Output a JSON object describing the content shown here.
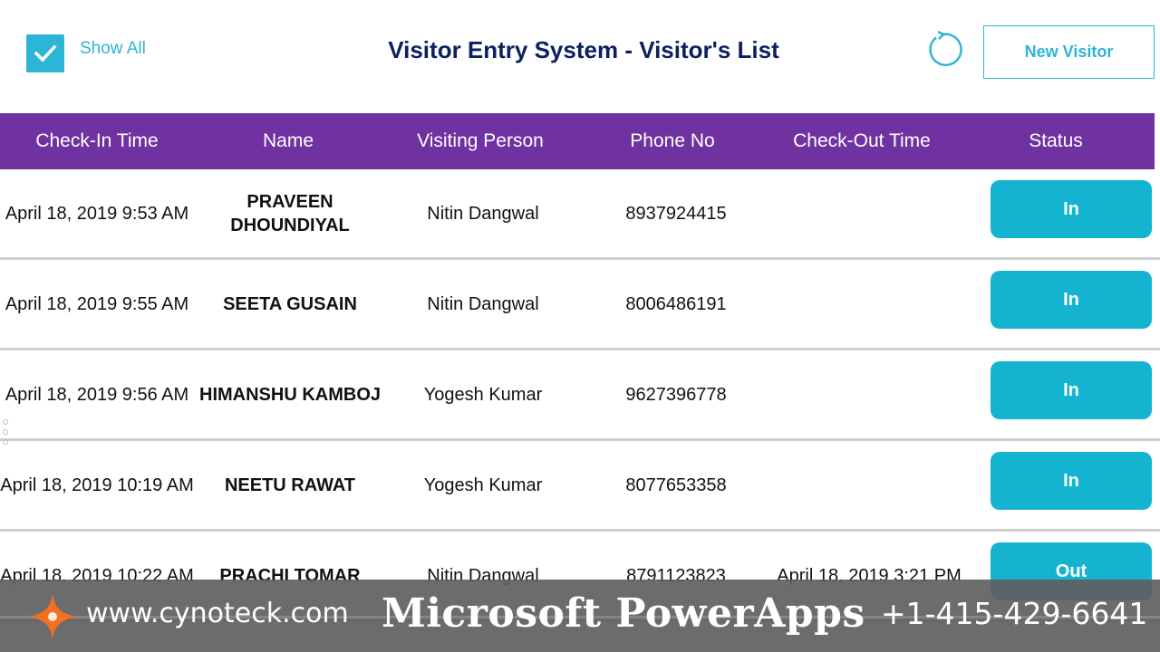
{
  "header": {
    "show_all_label": "Show All",
    "show_all_checked": true,
    "title": "Visitor Entry System - Visitor's List",
    "new_visitor_label": "New Visitor"
  },
  "table": {
    "columns": [
      "Check-In Time",
      "Name",
      "Visiting Person",
      "Phone No",
      "Check-Out Time",
      "Status"
    ],
    "rows": [
      {
        "checkin": "April 18, 2019 9:53 AM",
        "name": "PRAVEEN DHOUNDIYAL",
        "visiting": "Nitin Dangwal",
        "phone": "8937924415",
        "checkout": "",
        "status": "In"
      },
      {
        "checkin": "April 18, 2019 9:55 AM",
        "name": "SEETA GUSAIN",
        "visiting": "Nitin Dangwal",
        "phone": "8006486191",
        "checkout": "",
        "status": "In"
      },
      {
        "checkin": "April 18, 2019 9:56 AM",
        "name": "HIMANSHU KAMBOJ",
        "visiting": "Yogesh Kumar",
        "phone": "9627396778",
        "checkout": "",
        "status": "In"
      },
      {
        "checkin": "April 18, 2019 10:19 AM",
        "name": "NEETU RAWAT",
        "visiting": "Yogesh Kumar",
        "phone": "8077653358",
        "checkout": "",
        "status": "In"
      },
      {
        "checkin": "April 18, 2019 10:22 AM",
        "name": "PRACHI TOMAR",
        "visiting": "Nitin Dangwal",
        "phone": "8791123823",
        "checkout": "April 18, 2019 3:21 PM",
        "status": "Out"
      }
    ]
  },
  "banner": {
    "website": "www.cynoteck.com",
    "product": "Microsoft PowerApps",
    "phone": "+1-415-429-6641"
  },
  "icons": {
    "checkbox": "checkmark-icon",
    "refresh": "refresh-icon",
    "logo": "cynoteck-star-logo-icon"
  },
  "colors": {
    "accent": "#2bb5d6",
    "header_bg": "#6f32a0",
    "title": "#0d1f63",
    "status_button": "#14b4d1",
    "logo": "#f37021"
  }
}
